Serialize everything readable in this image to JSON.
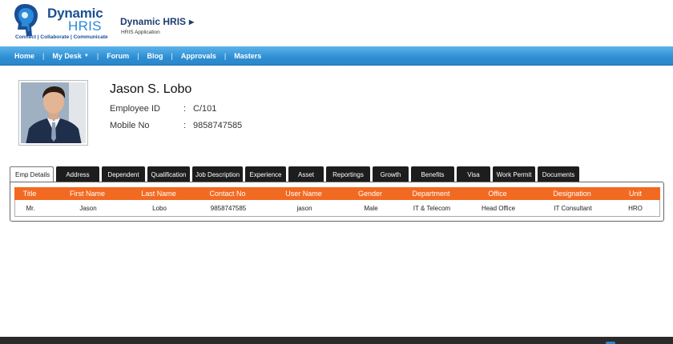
{
  "logo": {
    "word1": "Dynamic",
    "word2": "HRIS",
    "tagline": "Connect | Collaborate | Communicate",
    "colors": {
      "dark": "#1a4f96",
      "light": "#2a8ad8"
    }
  },
  "app": {
    "title": "Dynamic HRIS",
    "subtitle": "HRIS Application"
  },
  "nav": {
    "items": [
      "Home",
      "My Desk",
      "Forum",
      "Blog",
      "Approvals",
      "Masters"
    ],
    "separator": "|"
  },
  "employee": {
    "name": "Jason S. Lobo",
    "id_label": "Employee ID",
    "id_value": "C/101",
    "mobile_label": "Mobile No",
    "mobile_value": "9858747585",
    "colon": ":"
  },
  "tabs": [
    "Emp Details",
    "Address",
    "Dependent",
    "Qualification",
    "Job Description",
    "Experience",
    "Asset",
    "Reportings",
    "Growth",
    "Benefits",
    "Visa",
    "Work Permit",
    "Documents"
  ],
  "active_tab": "Emp Details",
  "table": {
    "columns": [
      "Title",
      "First Name",
      "Last Name",
      "Contact No",
      "User Name",
      "Gender",
      "Department",
      "Office",
      "Designation",
      "Unit"
    ],
    "rows": [
      [
        "Mr.",
        "Jason",
        "Lobo",
        "9858747585",
        "jason",
        "Male",
        "IT & Telecom",
        "Head Office",
        "IT Consultant",
        "HRO"
      ]
    ],
    "header_color": "#f26a22"
  },
  "colors": {
    "nav_blue": "#2e8ed3",
    "tab_dark": "#1d1d1d",
    "footer": "#2b2b2b"
  }
}
